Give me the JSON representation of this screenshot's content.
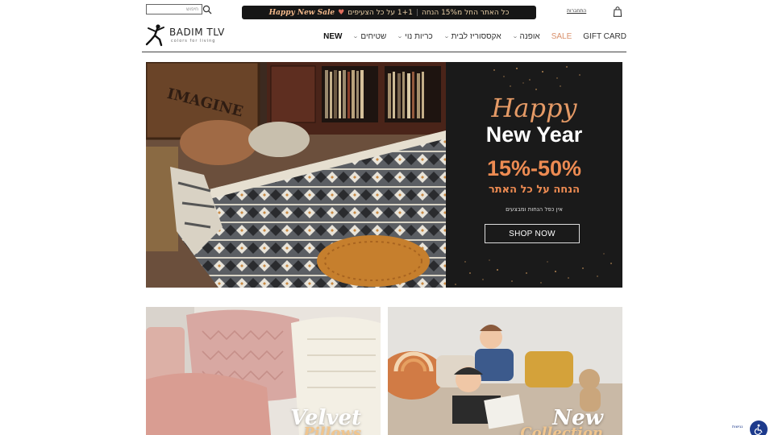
{
  "header": {
    "search_placeholder": "חיפוש",
    "promo": {
      "brand": "Happy New Sale",
      "text_main": "כל האתר החל מ15% הנחה",
      "text_extra": "1+1 על כל הצעיפים"
    },
    "account_label": "התחברות",
    "logo": {
      "name": "BADIM TLV",
      "tagline": "colors for living"
    }
  },
  "nav": {
    "items": [
      {
        "label": "NEW",
        "style": "new"
      },
      {
        "label": "שטיחים",
        "dropdown": true
      },
      {
        "label": "כריות נוי",
        "dropdown": true
      },
      {
        "label": "אקססוריז לבית",
        "dropdown": true
      },
      {
        "label": "אופנה",
        "dropdown": true
      },
      {
        "label": "SALE",
        "style": "sale"
      },
      {
        "label": "GIFT CARD"
      }
    ]
  },
  "hero": {
    "image_text": "IMAGINE",
    "happy": "Happy",
    "new_year": "New Year",
    "percent": "15%-50%",
    "subtitle": "הנחה על כל האתר",
    "small": "אין כפל הנחות ומבצעים",
    "button": "SHOP NOW",
    "colors": {
      "accent": "#ed8b52",
      "panel": "#1a1a1a"
    }
  },
  "tiles": [
    {
      "line1": "Velvet",
      "line2": "Pillows"
    },
    {
      "line1": "New",
      "line2": "Collection"
    }
  ],
  "accessibility": {
    "label": "נגישות"
  }
}
